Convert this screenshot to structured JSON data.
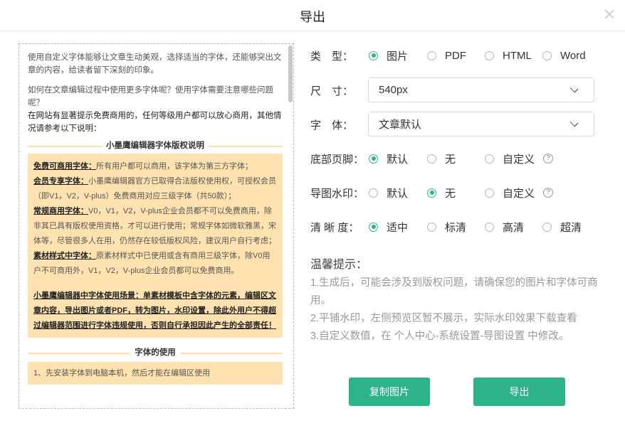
{
  "dialog": {
    "title": "导出"
  },
  "preview": {
    "intro": "使用自定义字体能够让文章生动美观，选择适当的字体，还能够突出文章的内容，给读者留下深刻的印象。",
    "question": "如何在文章编辑过程中使用更多字体呢？使用字体需要注意哪些问题呢？",
    "notice": "在网站有显著提示免费商用的，任何等级用户都可以放心商用，其他情况请参考以下说明：",
    "section1_title": "小墨鹰编辑器字体版权说明",
    "items": [
      {
        "key": "免费可商用字体：",
        "text": "所有用户都可以商用，该字体为第三方字体；"
      },
      {
        "key": "会员专享字体：",
        "text": "小墨鹰编辑器官方已取得合法版权使用权，可授权会员（即V1，V2，V-plus）免费商用对应三级字体（共50款）；"
      },
      {
        "key": "常规商用字体：",
        "text": "V0，V1，V2，V-plus企业会员都不可以免费商用，除非其已具有版权使用资格，才可以进行使用；常规字体如微软雅黑，宋体等，尽管很多人在用，仍然存在较低版权风险，建议用户自行考虑；"
      },
      {
        "key": "素材样式中字体：",
        "text": "原素材样式中已使用或含有商用三级字体，除V0用户不可商用外，V1，V2，V-plus企业会员都可以免费商用。"
      }
    ],
    "warning": "小墨鹰编辑器中字体使用场景：单素材模板中含字体的元素，编辑区文章内容，导出图片或者PDF，转为图片，水印设置，除此外用户不得超过编辑器范围进行字体违规使用，否则自行承担因此产生的全部责任！",
    "section2_title": "字体的使用",
    "usage": "1、先安装字体到电脑本机，然后才能在编辑区使用"
  },
  "form": {
    "type": {
      "label": "类　型：",
      "options": [
        "图片",
        "PDF",
        "HTML",
        "Word"
      ],
      "selected": "图片"
    },
    "size": {
      "label": "尺　寸：",
      "value": "540px"
    },
    "font": {
      "label": "字　体：",
      "value": "文章默认"
    },
    "footer": {
      "label": "底部页脚：",
      "options": [
        "默认",
        "无",
        "自定义"
      ],
      "selected": "默认",
      "help": "?"
    },
    "watermark": {
      "label": "导图水印：",
      "options": [
        "默认",
        "无",
        "自定义"
      ],
      "selected": "无",
      "help": "?"
    },
    "clarity": {
      "label": "清 晰 度：",
      "options": [
        "适中",
        "标清",
        "高清",
        "超清"
      ],
      "selected": "适中"
    }
  },
  "tips": {
    "title": "温馨提示：",
    "lines": [
      "1.生成后，可能会涉及到版权问题，请确保您的图片和字体可商用。",
      "2.平铺水印，左侧预览区暂不展示，实际水印效果下载查看",
      "3.自定义数值，在 个人中心-系统设置-导图设置 中修改。"
    ]
  },
  "buttons": {
    "copy": "复制图片",
    "export": "导出"
  },
  "colors": {
    "accent": "#2db38a",
    "highlight_bg": "#ffe2b0"
  }
}
